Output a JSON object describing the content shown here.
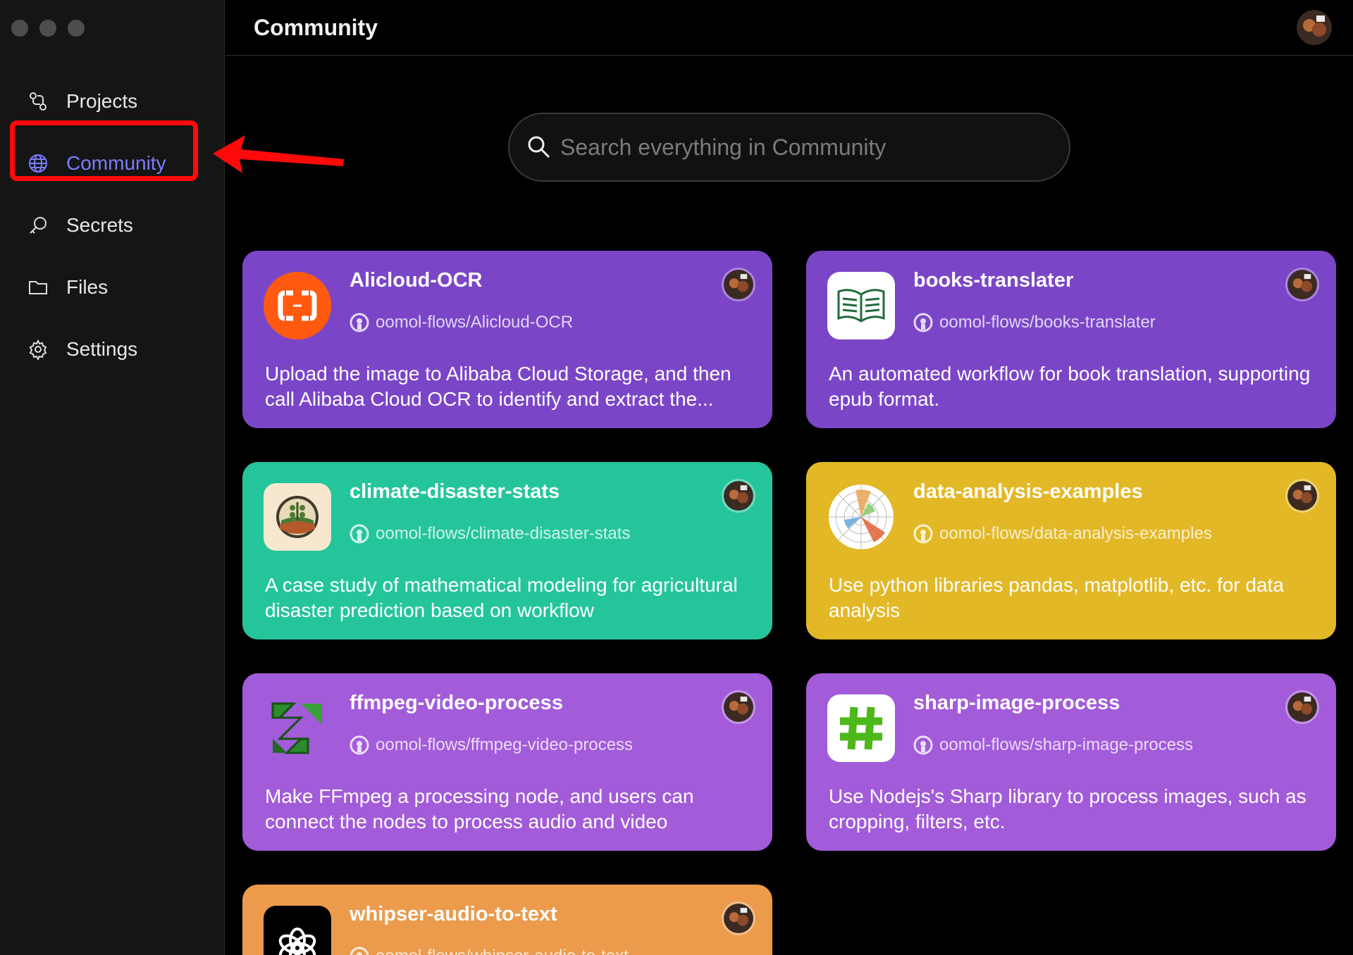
{
  "window": {
    "title": "Community"
  },
  "sidebar": {
    "items": [
      {
        "label": "Projects",
        "icon": "projects-icon"
      },
      {
        "label": "Community",
        "icon": "globe-icon",
        "active": true
      },
      {
        "label": "Secrets",
        "icon": "key-icon"
      },
      {
        "label": "Files",
        "icon": "folder-icon"
      },
      {
        "label": "Settings",
        "icon": "gear-icon"
      }
    ]
  },
  "search": {
    "placeholder": "Search everything in Community"
  },
  "colors": {
    "purple_dark": "#7b45c7",
    "teal": "#25c59b",
    "yellow": "#e2b826",
    "purple_light": "#a25bd9",
    "orange": "#ec9a4c",
    "active_nav": "#7a7dff",
    "annotation_red": "#ff0a0a"
  },
  "cards": [
    {
      "title": "Alicloud-OCR",
      "repo": "oomol-flows/Alicloud-OCR",
      "description": "Upload the image to Alibaba Cloud Storage, and then call Alibaba Cloud OCR to identify and extract the...",
      "icon": "alicloud-logo-icon"
    },
    {
      "title": "books-translater",
      "repo": "oomol-flows/books-translater",
      "description": "An automated workflow for book translation, supporting epub format.",
      "icon": "book-icon"
    },
    {
      "title": "climate-disaster-stats",
      "repo": "oomol-flows/climate-disaster-stats",
      "description": "A case study of mathematical modeling for agricultural disaster prediction based on workflow",
      "icon": "farm-icon"
    },
    {
      "title": "data-analysis-examples",
      "repo": "oomol-flows/data-analysis-examples",
      "description": "Use python libraries pandas, matplotlib, etc. for data analysis",
      "icon": "polar-chart-icon"
    },
    {
      "title": "ffmpeg-video-process",
      "repo": "oomol-flows/ffmpeg-video-process",
      "description": "Make FFmpeg a processing node, and users can connect the nodes to process audio and video",
      "icon": "ffmpeg-logo-icon"
    },
    {
      "title": "sharp-image-process",
      "repo": "oomol-flows/sharp-image-process",
      "description": "Use Nodejs's Sharp library to process images, such as cropping, filters, etc.",
      "icon": "hash-icon"
    },
    {
      "title": "whipser-audio-to-text",
      "repo": "oomol-flows/whipser-audio-to-text",
      "description": "",
      "icon": "openai-logo-icon"
    }
  ]
}
